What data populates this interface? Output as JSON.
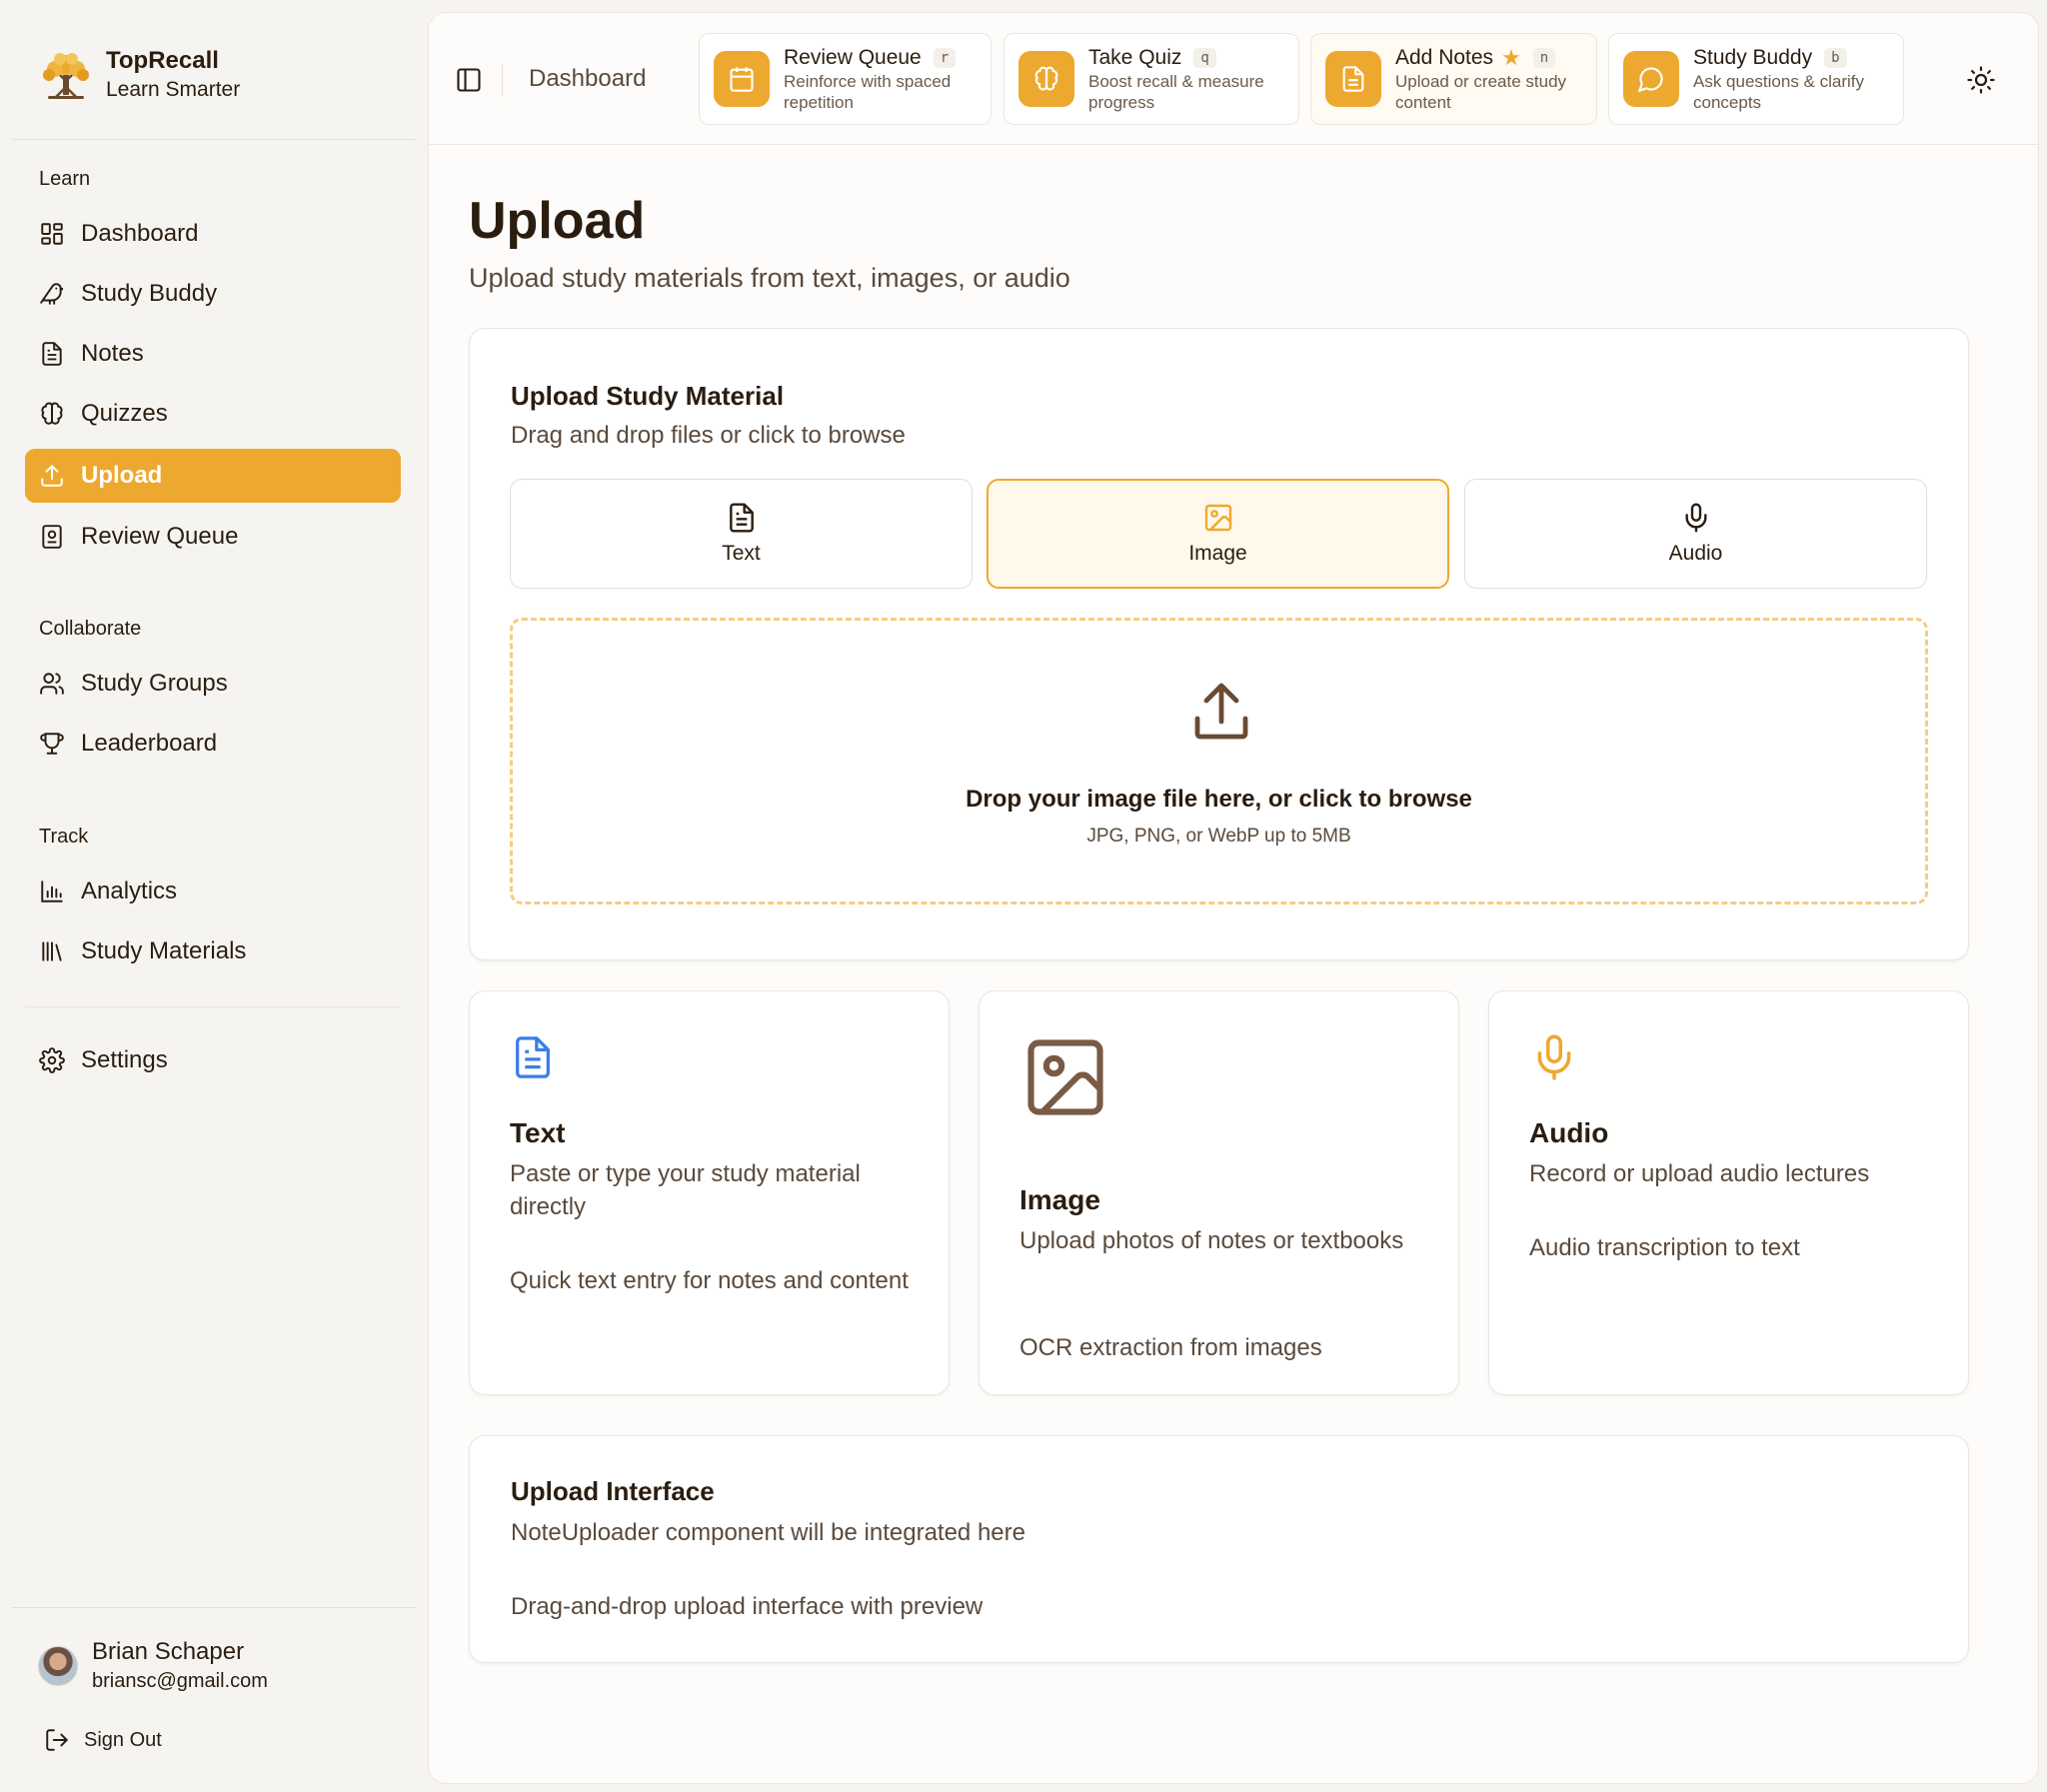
{
  "brand": {
    "name": "TopRecall",
    "tagline": "Learn Smarter"
  },
  "sidebar": {
    "sections": [
      {
        "label": "Learn"
      },
      {
        "label": "Collaborate"
      },
      {
        "label": "Track"
      }
    ],
    "items": [
      {
        "label": "Dashboard",
        "icon": "dashboard-icon"
      },
      {
        "label": "Study Buddy",
        "icon": "bird-icon"
      },
      {
        "label": "Notes",
        "icon": "file-text-icon"
      },
      {
        "label": "Quizzes",
        "icon": "brain-icon"
      },
      {
        "label": "Upload",
        "icon": "upload-icon",
        "active": true
      },
      {
        "label": "Review Queue",
        "icon": "review-icon"
      },
      {
        "label": "Study Groups",
        "icon": "users-icon"
      },
      {
        "label": "Leaderboard",
        "icon": "trophy-icon"
      },
      {
        "label": "Analytics",
        "icon": "bar-chart-icon"
      },
      {
        "label": "Study Materials",
        "icon": "library-icon"
      },
      {
        "label": "Settings",
        "icon": "gear-icon"
      }
    ]
  },
  "user": {
    "name": "Brian Schaper",
    "email": "briansc@gmail.com",
    "signout_label": "Sign Out"
  },
  "header": {
    "breadcrumb": "Dashboard",
    "quick_actions": [
      {
        "title": "Review Queue",
        "shortcut": "r",
        "desc": "Reinforce with spaced repetition",
        "icon": "calendar-icon"
      },
      {
        "title": "Take Quiz",
        "shortcut": "q",
        "desc": "Boost recall & measure progress",
        "icon": "brain-icon"
      },
      {
        "title": "Add Notes",
        "shortcut": "n",
        "desc": "Upload or create study content",
        "icon": "file-text-icon",
        "starred": true
      },
      {
        "title": "Study Buddy",
        "shortcut": "b",
        "desc": "Ask questions & clarify concepts",
        "icon": "chat-icon"
      }
    ]
  },
  "page": {
    "title": "Upload",
    "subtitle": "Upload study materials from text, images, or audio"
  },
  "upload_card": {
    "title": "Upload Study Material",
    "subtitle": "Drag and drop files or click to browse",
    "tabs": [
      {
        "label": "Text",
        "icon": "file-text-icon"
      },
      {
        "label": "Image",
        "icon": "image-icon",
        "active": true
      },
      {
        "label": "Audio",
        "icon": "mic-icon"
      }
    ],
    "dropzone": {
      "main": "Drop your image file here, or click to browse",
      "hint": "JPG, PNG, or WebP up to 5MB"
    }
  },
  "features": [
    {
      "title": "Text",
      "desc": "Paste or type your study material directly",
      "note": "Quick text entry for notes and content",
      "icon": "file-text-icon",
      "color": "#3b7de8"
    },
    {
      "title": "Image",
      "desc": "Upload photos of notes or textbooks",
      "note": "OCR extraction from images",
      "icon": "image-icon",
      "color": "#7a5a44"
    },
    {
      "title": "Audio",
      "desc": "Record or upload audio lectures",
      "note": "Audio transcription to text",
      "icon": "mic-icon",
      "color": "#eda92f"
    }
  ],
  "interface_card": {
    "title": "Upload Interface",
    "subtitle": "NoteUploader component will be integrated here",
    "note": "Drag-and-drop upload interface with preview"
  },
  "colors": {
    "accent": "#eda92f",
    "text": "#2a1d10",
    "muted": "#5a4a3c",
    "blue": "#3b7de8"
  }
}
